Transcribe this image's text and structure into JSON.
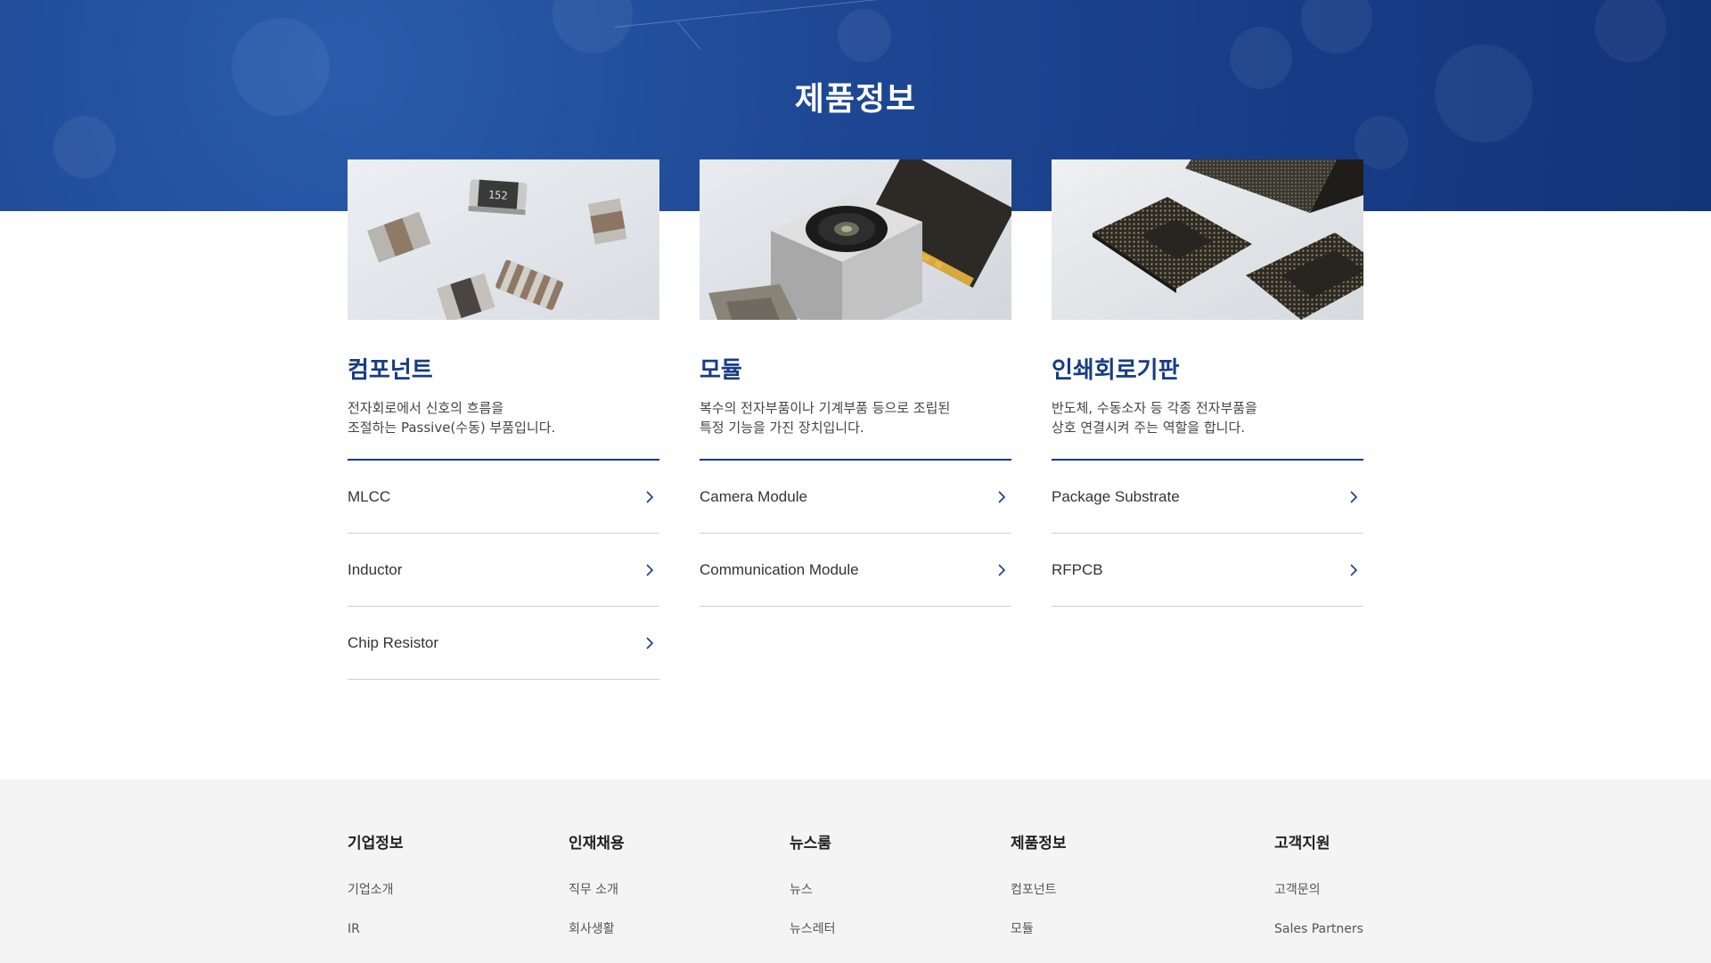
{
  "hero": {
    "title": "제품정보",
    "background_color": "#173c86"
  },
  "products": [
    {
      "title": "컴포넌트",
      "description_line1": "전자회로에서 신호의 흐름을",
      "description_line2": "조절하는 Passive(수동) 부품입니다.",
      "items": [
        "MLCC",
        "Inductor",
        "Chip Resistor"
      ]
    },
    {
      "title": "모듈",
      "description_line1": "복수의 전자부품이나 기계부품 등으로 조립된",
      "description_line2": "특정 기능을 가진 장치입니다.",
      "items": [
        "Camera Module",
        "Communication Module"
      ]
    },
    {
      "title": "인쇄회로기판",
      "description_line1": "반도체, 수동소자 등 각종 전자부품을",
      "description_line2": "상호 연결시켜 주는 역할을 합니다.",
      "items": [
        "Package Substrate",
        "RFPCB"
      ]
    }
  ],
  "footer": {
    "columns": [
      {
        "heading": "기업정보",
        "links": [
          "기업소개",
          "IR"
        ]
      },
      {
        "heading": "인재채용",
        "links": [
          "직무 소개",
          "회사생활"
        ]
      },
      {
        "heading": "뉴스룸",
        "links": [
          "뉴스",
          "뉴스레터"
        ]
      },
      {
        "heading": "제품정보",
        "links": [
          "컴포넌트",
          "모듈"
        ]
      },
      {
        "heading": "고객지원",
        "links": [
          "고객문의",
          "Sales Partners"
        ]
      }
    ]
  },
  "colors": {
    "accent": "#173c86",
    "footer_bg": "#f4f4f4",
    "divider": "#cfcfcf"
  },
  "icons": {
    "item_arrow": "chevron-right-icon"
  }
}
